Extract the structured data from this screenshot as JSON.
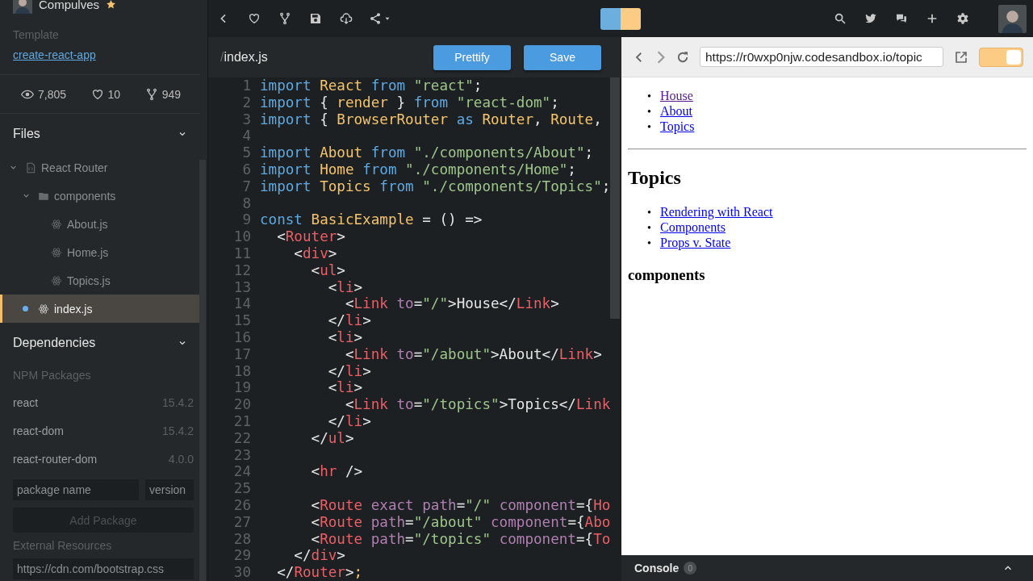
{
  "profile": {
    "name": "Compulves"
  },
  "template": {
    "label": "Template",
    "link": "create-react-app"
  },
  "stats": [
    {
      "kind": "views",
      "value": "7,805"
    },
    {
      "kind": "likes",
      "value": "10"
    },
    {
      "kind": "forks",
      "value": "949"
    }
  ],
  "files": {
    "title": "Files",
    "expanded": true,
    "tree": [
      {
        "name": "React Router",
        "kind": "project",
        "expanded": true,
        "selected": false,
        "children": [
          {
            "name": "components",
            "kind": "folder",
            "expanded": true,
            "selected": false,
            "children": [
              {
                "name": "About.js",
                "kind": "react",
                "selected": false
              },
              {
                "name": "Home.js",
                "kind": "react",
                "selected": false
              },
              {
                "name": "Topics.js",
                "kind": "react",
                "selected": false
              }
            ]
          },
          {
            "name": "index.js",
            "kind": "react",
            "selected": true
          }
        ]
      }
    ]
  },
  "dependencies": {
    "title": "Dependencies",
    "expanded": true,
    "npm_label": "NPM Packages",
    "packages": [
      {
        "name": "react",
        "version": "15.4.2"
      },
      {
        "name": "react-dom",
        "version": "15.4.2"
      },
      {
        "name": "react-router-dom",
        "version": "4.0.0"
      }
    ],
    "package_input": {
      "placeholder": "package name"
    },
    "version_input": {
      "placeholder": "version"
    },
    "add_button": {
      "label": "Add Package",
      "disabled": true
    },
    "external_label": "External Resources",
    "resource_input": {
      "placeholder": "https://cdn.com/bootstrap.css"
    }
  },
  "editor": {
    "path_prefix": "/",
    "filename": "index.js",
    "buttons": [
      {
        "label": "Prettify"
      },
      {
        "label": "Save"
      }
    ],
    "lines": [
      {
        "number": "1",
        "tokens": [
          {
            "kind": "kw",
            "text": "import "
          },
          {
            "kind": "id",
            "text": "React "
          },
          {
            "kind": "kw",
            "text": "from "
          },
          {
            "kind": "str",
            "text": "\"react\""
          },
          {
            "kind": "p",
            "text": ";"
          }
        ]
      },
      {
        "number": "2",
        "tokens": [
          {
            "kind": "kw",
            "text": "import "
          },
          {
            "kind": "p",
            "text": "{ "
          },
          {
            "kind": "id",
            "text": "render "
          },
          {
            "kind": "p",
            "text": "} "
          },
          {
            "kind": "kw",
            "text": "from "
          },
          {
            "kind": "str",
            "text": "\"react-dom\""
          },
          {
            "kind": "p",
            "text": ";"
          }
        ]
      },
      {
        "number": "3",
        "tokens": [
          {
            "kind": "kw",
            "text": "import "
          },
          {
            "kind": "p",
            "text": "{ "
          },
          {
            "kind": "id",
            "text": "BrowserRouter "
          },
          {
            "kind": "kw",
            "text": "as "
          },
          {
            "kind": "id",
            "text": "Router"
          },
          {
            "kind": "p",
            "text": ", "
          },
          {
            "kind": "id",
            "text": "Route"
          },
          {
            "kind": "p",
            "text": ","
          }
        ]
      },
      {
        "number": "4"
      },
      {
        "number": "5",
        "tokens": [
          {
            "kind": "kw",
            "text": "import "
          },
          {
            "kind": "id",
            "text": "About "
          },
          {
            "kind": "kw",
            "text": "from "
          },
          {
            "kind": "str",
            "text": "\"./components/About\""
          },
          {
            "kind": "p",
            "text": ";"
          }
        ]
      },
      {
        "number": "6",
        "tokens": [
          {
            "kind": "kw",
            "text": "import "
          },
          {
            "kind": "id",
            "text": "Home "
          },
          {
            "kind": "kw",
            "text": "from "
          },
          {
            "kind": "str",
            "text": "\"./components/Home\""
          },
          {
            "kind": "p",
            "text": ";"
          }
        ]
      },
      {
        "number": "7",
        "tokens": [
          {
            "kind": "kw",
            "text": "import "
          },
          {
            "kind": "id",
            "text": "Topics "
          },
          {
            "kind": "kw",
            "text": "from "
          },
          {
            "kind": "str",
            "text": "\"./components/Topics\""
          },
          {
            "kind": "p",
            "text": ";"
          }
        ]
      },
      {
        "number": "8"
      },
      {
        "number": "9",
        "tokens": [
          {
            "kind": "kw",
            "text": "const "
          },
          {
            "kind": "id",
            "text": "BasicExample "
          },
          {
            "kind": "p",
            "text": "= () =>"
          }
        ]
      },
      {
        "number": "10",
        "tokens": [
          {
            "kind": "p",
            "text": "  <"
          },
          {
            "kind": "tag",
            "text": "Router"
          },
          {
            "kind": "p",
            "text": ">"
          }
        ]
      },
      {
        "number": "11",
        "tokens": [
          {
            "kind": "p",
            "text": "    <"
          },
          {
            "kind": "tag",
            "text": "div"
          },
          {
            "kind": "p",
            "text": ">"
          }
        ]
      },
      {
        "number": "12",
        "tokens": [
          {
            "kind": "p",
            "text": "      <"
          },
          {
            "kind": "tag",
            "text": "ul"
          },
          {
            "kind": "p",
            "text": ">"
          }
        ]
      },
      {
        "number": "13",
        "tokens": [
          {
            "kind": "p",
            "text": "        <"
          },
          {
            "kind": "tag",
            "text": "li"
          },
          {
            "kind": "p",
            "text": ">"
          }
        ]
      },
      {
        "number": "14",
        "tokens": [
          {
            "kind": "p",
            "text": "          <"
          },
          {
            "kind": "tag",
            "text": "Link "
          },
          {
            "kind": "attr",
            "text": "to"
          },
          {
            "kind": "p",
            "text": "="
          },
          {
            "kind": "str",
            "text": "\"/\""
          },
          {
            "kind": "p",
            "text": ">House</"
          },
          {
            "kind": "tag",
            "text": "Link"
          },
          {
            "kind": "p",
            "text": ">"
          }
        ]
      },
      {
        "number": "15",
        "tokens": [
          {
            "kind": "p",
            "text": "        </"
          },
          {
            "kind": "tag",
            "text": "li"
          },
          {
            "kind": "p",
            "text": ">"
          }
        ]
      },
      {
        "number": "16",
        "tokens": [
          {
            "kind": "p",
            "text": "        <"
          },
          {
            "kind": "tag",
            "text": "li"
          },
          {
            "kind": "p",
            "text": ">"
          }
        ]
      },
      {
        "number": "17",
        "tokens": [
          {
            "kind": "p",
            "text": "          <"
          },
          {
            "kind": "tag",
            "text": "Link "
          },
          {
            "kind": "attr",
            "text": "to"
          },
          {
            "kind": "p",
            "text": "="
          },
          {
            "kind": "str",
            "text": "\"/about\""
          },
          {
            "kind": "p",
            "text": ">About</"
          },
          {
            "kind": "tag",
            "text": "Link"
          },
          {
            "kind": "p",
            "text": ">"
          }
        ]
      },
      {
        "number": "18",
        "tokens": [
          {
            "kind": "p",
            "text": "        </"
          },
          {
            "kind": "tag",
            "text": "li"
          },
          {
            "kind": "p",
            "text": ">"
          }
        ]
      },
      {
        "number": "19",
        "tokens": [
          {
            "kind": "p",
            "text": "        <"
          },
          {
            "kind": "tag",
            "text": "li"
          },
          {
            "kind": "p",
            "text": ">"
          }
        ]
      },
      {
        "number": "20",
        "tokens": [
          {
            "kind": "p",
            "text": "          <"
          },
          {
            "kind": "tag",
            "text": "Link "
          },
          {
            "kind": "attr",
            "text": "to"
          },
          {
            "kind": "p",
            "text": "="
          },
          {
            "kind": "str",
            "text": "\"/topics\""
          },
          {
            "kind": "p",
            "text": ">Topics</"
          },
          {
            "kind": "tag",
            "text": "Link"
          }
        ]
      },
      {
        "number": "21",
        "tokens": [
          {
            "kind": "p",
            "text": "        </"
          },
          {
            "kind": "tag",
            "text": "li"
          },
          {
            "kind": "p",
            "text": ">"
          }
        ]
      },
      {
        "number": "22",
        "tokens": [
          {
            "kind": "p",
            "text": "      </"
          },
          {
            "kind": "tag",
            "text": "ul"
          },
          {
            "kind": "p",
            "text": ">"
          }
        ]
      },
      {
        "number": "23"
      },
      {
        "number": "24",
        "tokens": [
          {
            "kind": "p",
            "text": "      <"
          },
          {
            "kind": "tag",
            "text": "hr"
          },
          {
            "kind": "p",
            "text": " />"
          }
        ]
      },
      {
        "number": "25"
      },
      {
        "number": "26",
        "tokens": [
          {
            "kind": "p",
            "text": "      <"
          },
          {
            "kind": "tag",
            "text": "Route "
          },
          {
            "kind": "attr",
            "text": "exact path"
          },
          {
            "kind": "p",
            "text": "="
          },
          {
            "kind": "str",
            "text": "\"/\" "
          },
          {
            "kind": "attr",
            "text": "component"
          },
          {
            "kind": "p",
            "text": "={"
          },
          {
            "kind": "tag",
            "text": "Ho"
          }
        ]
      },
      {
        "number": "27",
        "tokens": [
          {
            "kind": "p",
            "text": "      <"
          },
          {
            "kind": "tag",
            "text": "Route "
          },
          {
            "kind": "attr",
            "text": "path"
          },
          {
            "kind": "p",
            "text": "="
          },
          {
            "kind": "str",
            "text": "\"/about\" "
          },
          {
            "kind": "attr",
            "text": "component"
          },
          {
            "kind": "p",
            "text": "={"
          },
          {
            "kind": "tag",
            "text": "Abo"
          }
        ]
      },
      {
        "number": "28",
        "tokens": [
          {
            "kind": "p",
            "text": "      <"
          },
          {
            "kind": "tag",
            "text": "Route "
          },
          {
            "kind": "attr",
            "text": "path"
          },
          {
            "kind": "p",
            "text": "="
          },
          {
            "kind": "str",
            "text": "\"/topics\" "
          },
          {
            "kind": "attr",
            "text": "component"
          },
          {
            "kind": "p",
            "text": "={"
          },
          {
            "kind": "tag",
            "text": "To"
          }
        ]
      },
      {
        "number": "29",
        "tokens": [
          {
            "kind": "p",
            "text": "    </"
          },
          {
            "kind": "tag",
            "text": "div"
          },
          {
            "kind": "p",
            "text": ">"
          }
        ]
      },
      {
        "number": "30",
        "tokens": [
          {
            "kind": "p",
            "text": "  </"
          },
          {
            "kind": "tag",
            "text": "Router"
          },
          {
            "kind": "p",
            "text": ">"
          },
          {
            "kind": "id",
            "text": ";"
          }
        ]
      }
    ]
  },
  "preview": {
    "url": "https://r0wxp0njw.codesandbox.io/topic",
    "toggle_on": true,
    "nav_links": [
      {
        "bullet": "•",
        "label": "House",
        "visited": true
      },
      {
        "bullet": "•",
        "label": "About",
        "visited": false
      },
      {
        "bullet": "•",
        "label": "Topics",
        "visited": false
      }
    ],
    "heading": "Topics",
    "topic_links": [
      {
        "bullet": "•",
        "label": "Rendering with React",
        "visited": false
      },
      {
        "bullet": "•",
        "label": "Components",
        "visited": false
      },
      {
        "bullet": "•",
        "label": "Props v. State",
        "visited": false
      }
    ],
    "subheading": "components"
  },
  "console": {
    "label": "Console",
    "count": "0",
    "expanded": false
  }
}
